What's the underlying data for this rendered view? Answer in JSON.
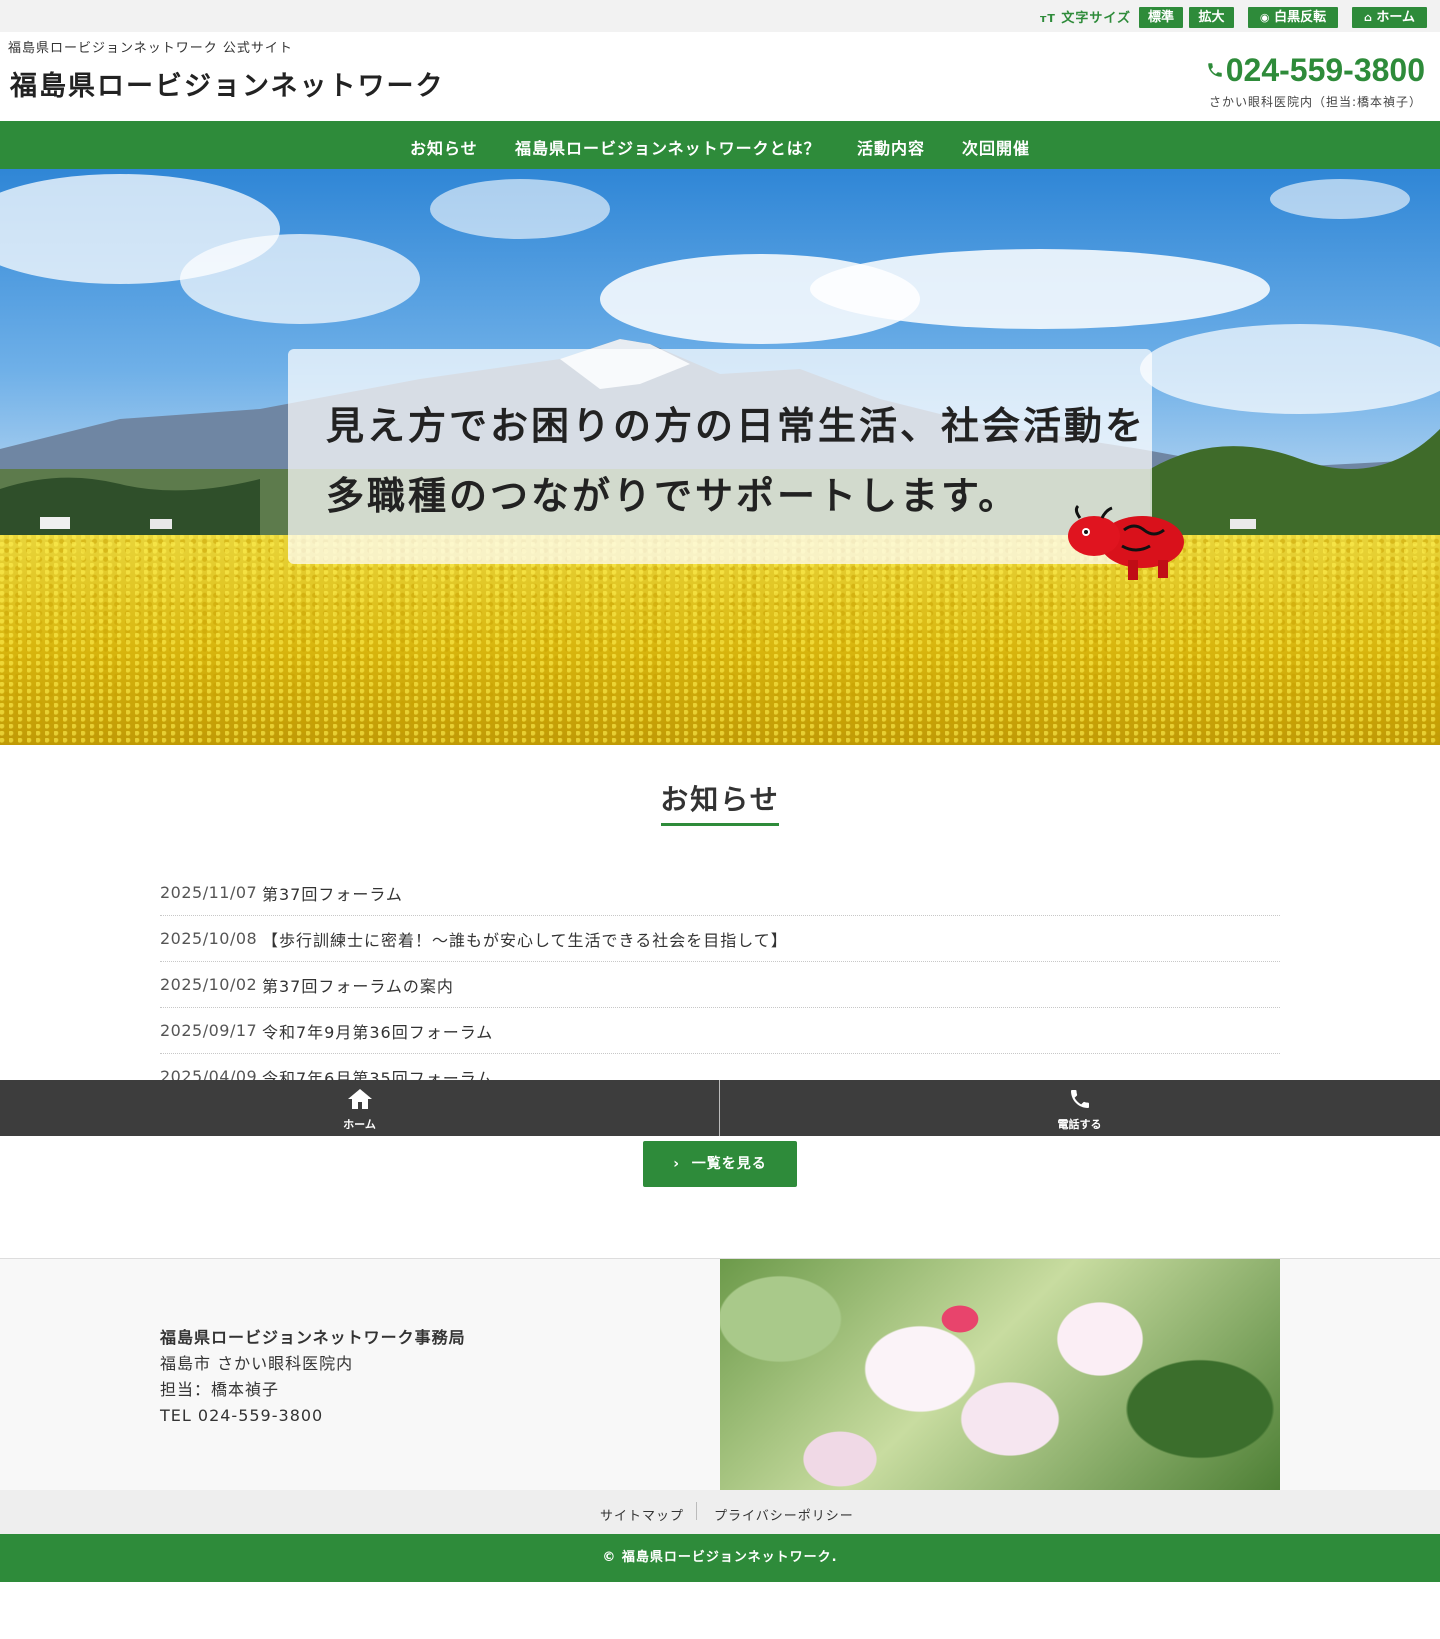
{
  "utility": {
    "text_size_label": "文字サイズ",
    "standard": "標準",
    "enlarge": "拡大",
    "invert": "白黒反転",
    "home": "ホーム"
  },
  "header": {
    "tagline": "福島県ロービジョンネットワーク 公式サイト",
    "title": "福島県ロービジョンネットワーク",
    "phone": "024-559-3800",
    "phone_note": "さかい眼科医院内（担当:橋本禎子）"
  },
  "nav": {
    "items": [
      "お知らせ",
      "福島県ロービジョンネットワークとは？",
      "活動内容",
      "次回開催"
    ]
  },
  "hero": {
    "line1": "見え方でお困りの方の日常生活、社会活動を",
    "line2": "多職種のつながりでサポートします。"
  },
  "news": {
    "heading": "お知らせ",
    "items": [
      {
        "date": "2025/11/07",
        "title": "第37回フォーラム"
      },
      {
        "date": "2025/10/08",
        "title": "【歩行訓練士に密着！〜誰もが安心して生活できる社会を目指して】"
      },
      {
        "date": "2025/10/02",
        "title": "第37回フォーラムの案内"
      },
      {
        "date": "2025/09/17",
        "title": "令和7年9月第36回フォーラム"
      },
      {
        "date": "2025/04/09",
        "title": "令和7年6月第35回フォーラム"
      }
    ],
    "more_label": "一覧を見る"
  },
  "fixbar": {
    "home_label": "ホーム",
    "call_label": "電話する"
  },
  "footer": {
    "org": "福島県ロービジョンネットワーク事務局",
    "address": "福島市 さかい眼科医院内",
    "contact": "担当：橋本禎子",
    "tel": "TEL 024-559-3800",
    "links": [
      "サイトマップ",
      "プライバシーポリシー"
    ],
    "copyright": "© 福島県ロービジョンネットワーク."
  },
  "colors": {
    "brand_green": "#2e8b3a",
    "fixbar_dark": "#3d3d3d"
  }
}
